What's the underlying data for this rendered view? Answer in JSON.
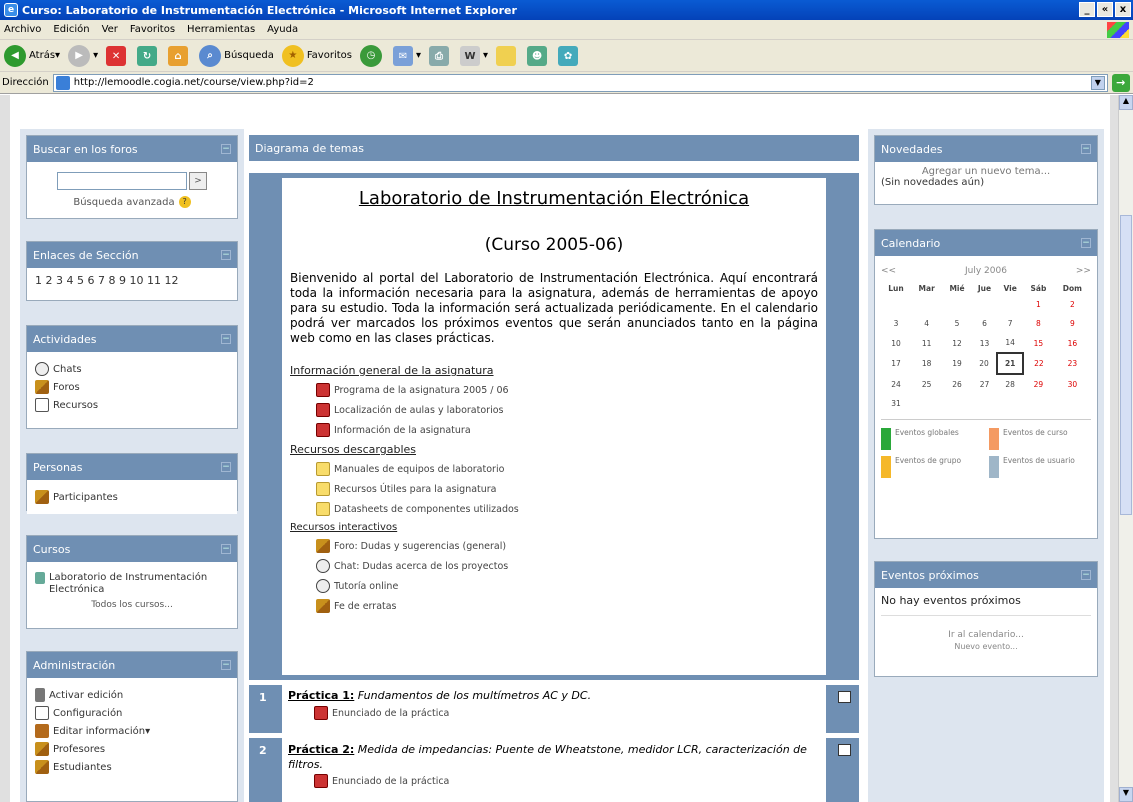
{
  "window": {
    "title": "Curso: Laboratorio de Instrumentación Electrónica - Microsoft Internet Explorer",
    "controls": [
      "_",
      "«",
      "x"
    ]
  },
  "menu": [
    "Archivo",
    "Edición",
    "Ver",
    "Favoritos",
    "Herramientas",
    "Ayuda"
  ],
  "toolbar": {
    "back": "Atrás",
    "search": "Búsqueda",
    "favorites": "Favoritos"
  },
  "address": {
    "label": "Dirección",
    "url": "http://lemoodle.cogia.net/course/view.php?id=2"
  },
  "left": {
    "search": {
      "title": "Buscar en los foros",
      "go": ">",
      "advanced": "Búsqueda avanzada"
    },
    "sections": {
      "title": "Enlaces de Sección",
      "numbers": "1 2 3 4 5 6 7 8 9 10 11 12"
    },
    "activities": {
      "title": "Actividades",
      "items": [
        "Chats",
        "Foros",
        "Recursos"
      ]
    },
    "people": {
      "title": "Personas",
      "items": [
        "Participantes"
      ]
    },
    "courses": {
      "title": "Cursos",
      "course": "Laboratorio de Instrumentación Electrónica",
      "all": "Todos los cursos..."
    },
    "admin": {
      "title": "Administración",
      "items": [
        "Activar edición",
        "Configuración",
        "Editar información",
        "Profesores",
        "Estudiantes"
      ]
    }
  },
  "center": {
    "header": "Diagrama de temas",
    "title": "Laboratorio de Instrumentación Electrónica",
    "subtitle": "(Curso 2005-06)",
    "intro": "Bienvenido al portal del Laboratorio de Instrumentación Electrónica. Aquí encontrará toda la información necesaria para la asignatura, además de herramientas de apoyo para su estudio. Toda la información será actualizada periódicamente. En el calendario podrá ver marcados los próximos eventos que serán anunciados tanto en la página web como en las clases prácticas.",
    "sec1": {
      "title": "Información general de la asignatura",
      "links": [
        "Programa de la asignatura 2005 / 06",
        "Localización de aulas y laboratorios",
        "Información de la asignatura"
      ]
    },
    "sec2": {
      "title": "Recursos descargables",
      "links": [
        "Manuales de equipos de laboratorio",
        "Recursos Útiles para la asignatura",
        "Datasheets de componentes utilizados"
      ]
    },
    "sec3": {
      "title": "Recursos interactivos",
      "links": [
        "Foro: Dudas y sugerencias (general)",
        "Chat: Dudas acerca de los proyectos",
        "Tutoría online",
        "Fe de erratas"
      ]
    },
    "p1": {
      "num": "1",
      "label": "Práctica 1:",
      "desc": "Fundamentos de los multímetros AC y DC.",
      "link": "Enunciado de la práctica"
    },
    "p2": {
      "num": "2",
      "label": "Práctica 2:",
      "desc": "Medida de impedancias: Puente de Wheatstone, medidor LCR, caracterización de filtros.",
      "link": "Enunciado de la práctica"
    }
  },
  "right": {
    "news": {
      "title": "Novedades",
      "add": "Agregar un nuevo tema...",
      "none": "(Sin novedades aún)"
    },
    "calendar": {
      "title": "Calendario",
      "prev": "<<",
      "next": ">>",
      "month": "July 2006",
      "days": [
        "Lun",
        "Mar",
        "Mié",
        "Jue",
        "Vie",
        "Sáb",
        "Dom"
      ],
      "weeks": [
        [
          "",
          "",
          "",
          "",
          "",
          "1",
          "2"
        ],
        [
          "3",
          "4",
          "5",
          "6",
          "7",
          "8",
          "9"
        ],
        [
          "10",
          "11",
          "12",
          "13",
          "14",
          "15",
          "16"
        ],
        [
          "17",
          "18",
          "19",
          "20",
          "21",
          "22",
          "23"
        ],
        [
          "24",
          "25",
          "26",
          "27",
          "28",
          "29",
          "30"
        ],
        [
          "31",
          "",
          "",
          "",
          "",
          "",
          ""
        ]
      ],
      "today": "21",
      "legend": [
        {
          "label": "Eventos globales",
          "color": "#2aa83a"
        },
        {
          "label": "Eventos de curso",
          "color": "#f49a62"
        },
        {
          "label": "Eventos de grupo",
          "color": "#f5b82a"
        },
        {
          "label": "Eventos de usuario",
          "color": "#9fb6c8"
        }
      ]
    },
    "upcoming": {
      "title": "Eventos próximos",
      "none": "No hay eventos próximos",
      "go": "Ir al calendario...",
      "new": "Nuevo evento..."
    }
  }
}
